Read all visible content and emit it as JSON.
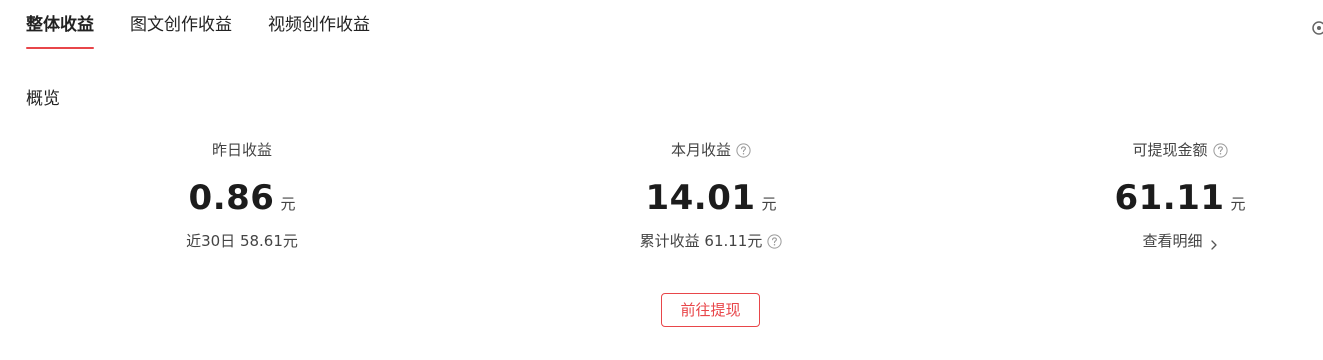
{
  "tabs": [
    {
      "label": "整体收益",
      "active": true
    },
    {
      "label": "图文创作收益",
      "active": false
    },
    {
      "label": "视频创作收益",
      "active": false
    }
  ],
  "overview": {
    "title": "概览"
  },
  "stats": {
    "yesterday": {
      "label": "昨日收益",
      "value": "0.86",
      "unit": "元",
      "sub": "近30日 58.61元"
    },
    "month": {
      "label": "本月收益",
      "value": "14.01",
      "unit": "元",
      "sub": "累计收益 61.11元"
    },
    "withdrawable": {
      "label": "可提现金额",
      "value": "61.11",
      "unit": "元",
      "sub": "查看明细"
    }
  },
  "withdraw_button": {
    "label": "前往提现"
  },
  "colors": {
    "accent": "#e8464a",
    "text_primary": "#222222",
    "text_secondary": "#444444",
    "icon_gray": "#9a9a9a"
  },
  "icons": {
    "help": "question-circle-icon",
    "chevron": "chevron-right-icon",
    "corner": "settings-icon"
  }
}
